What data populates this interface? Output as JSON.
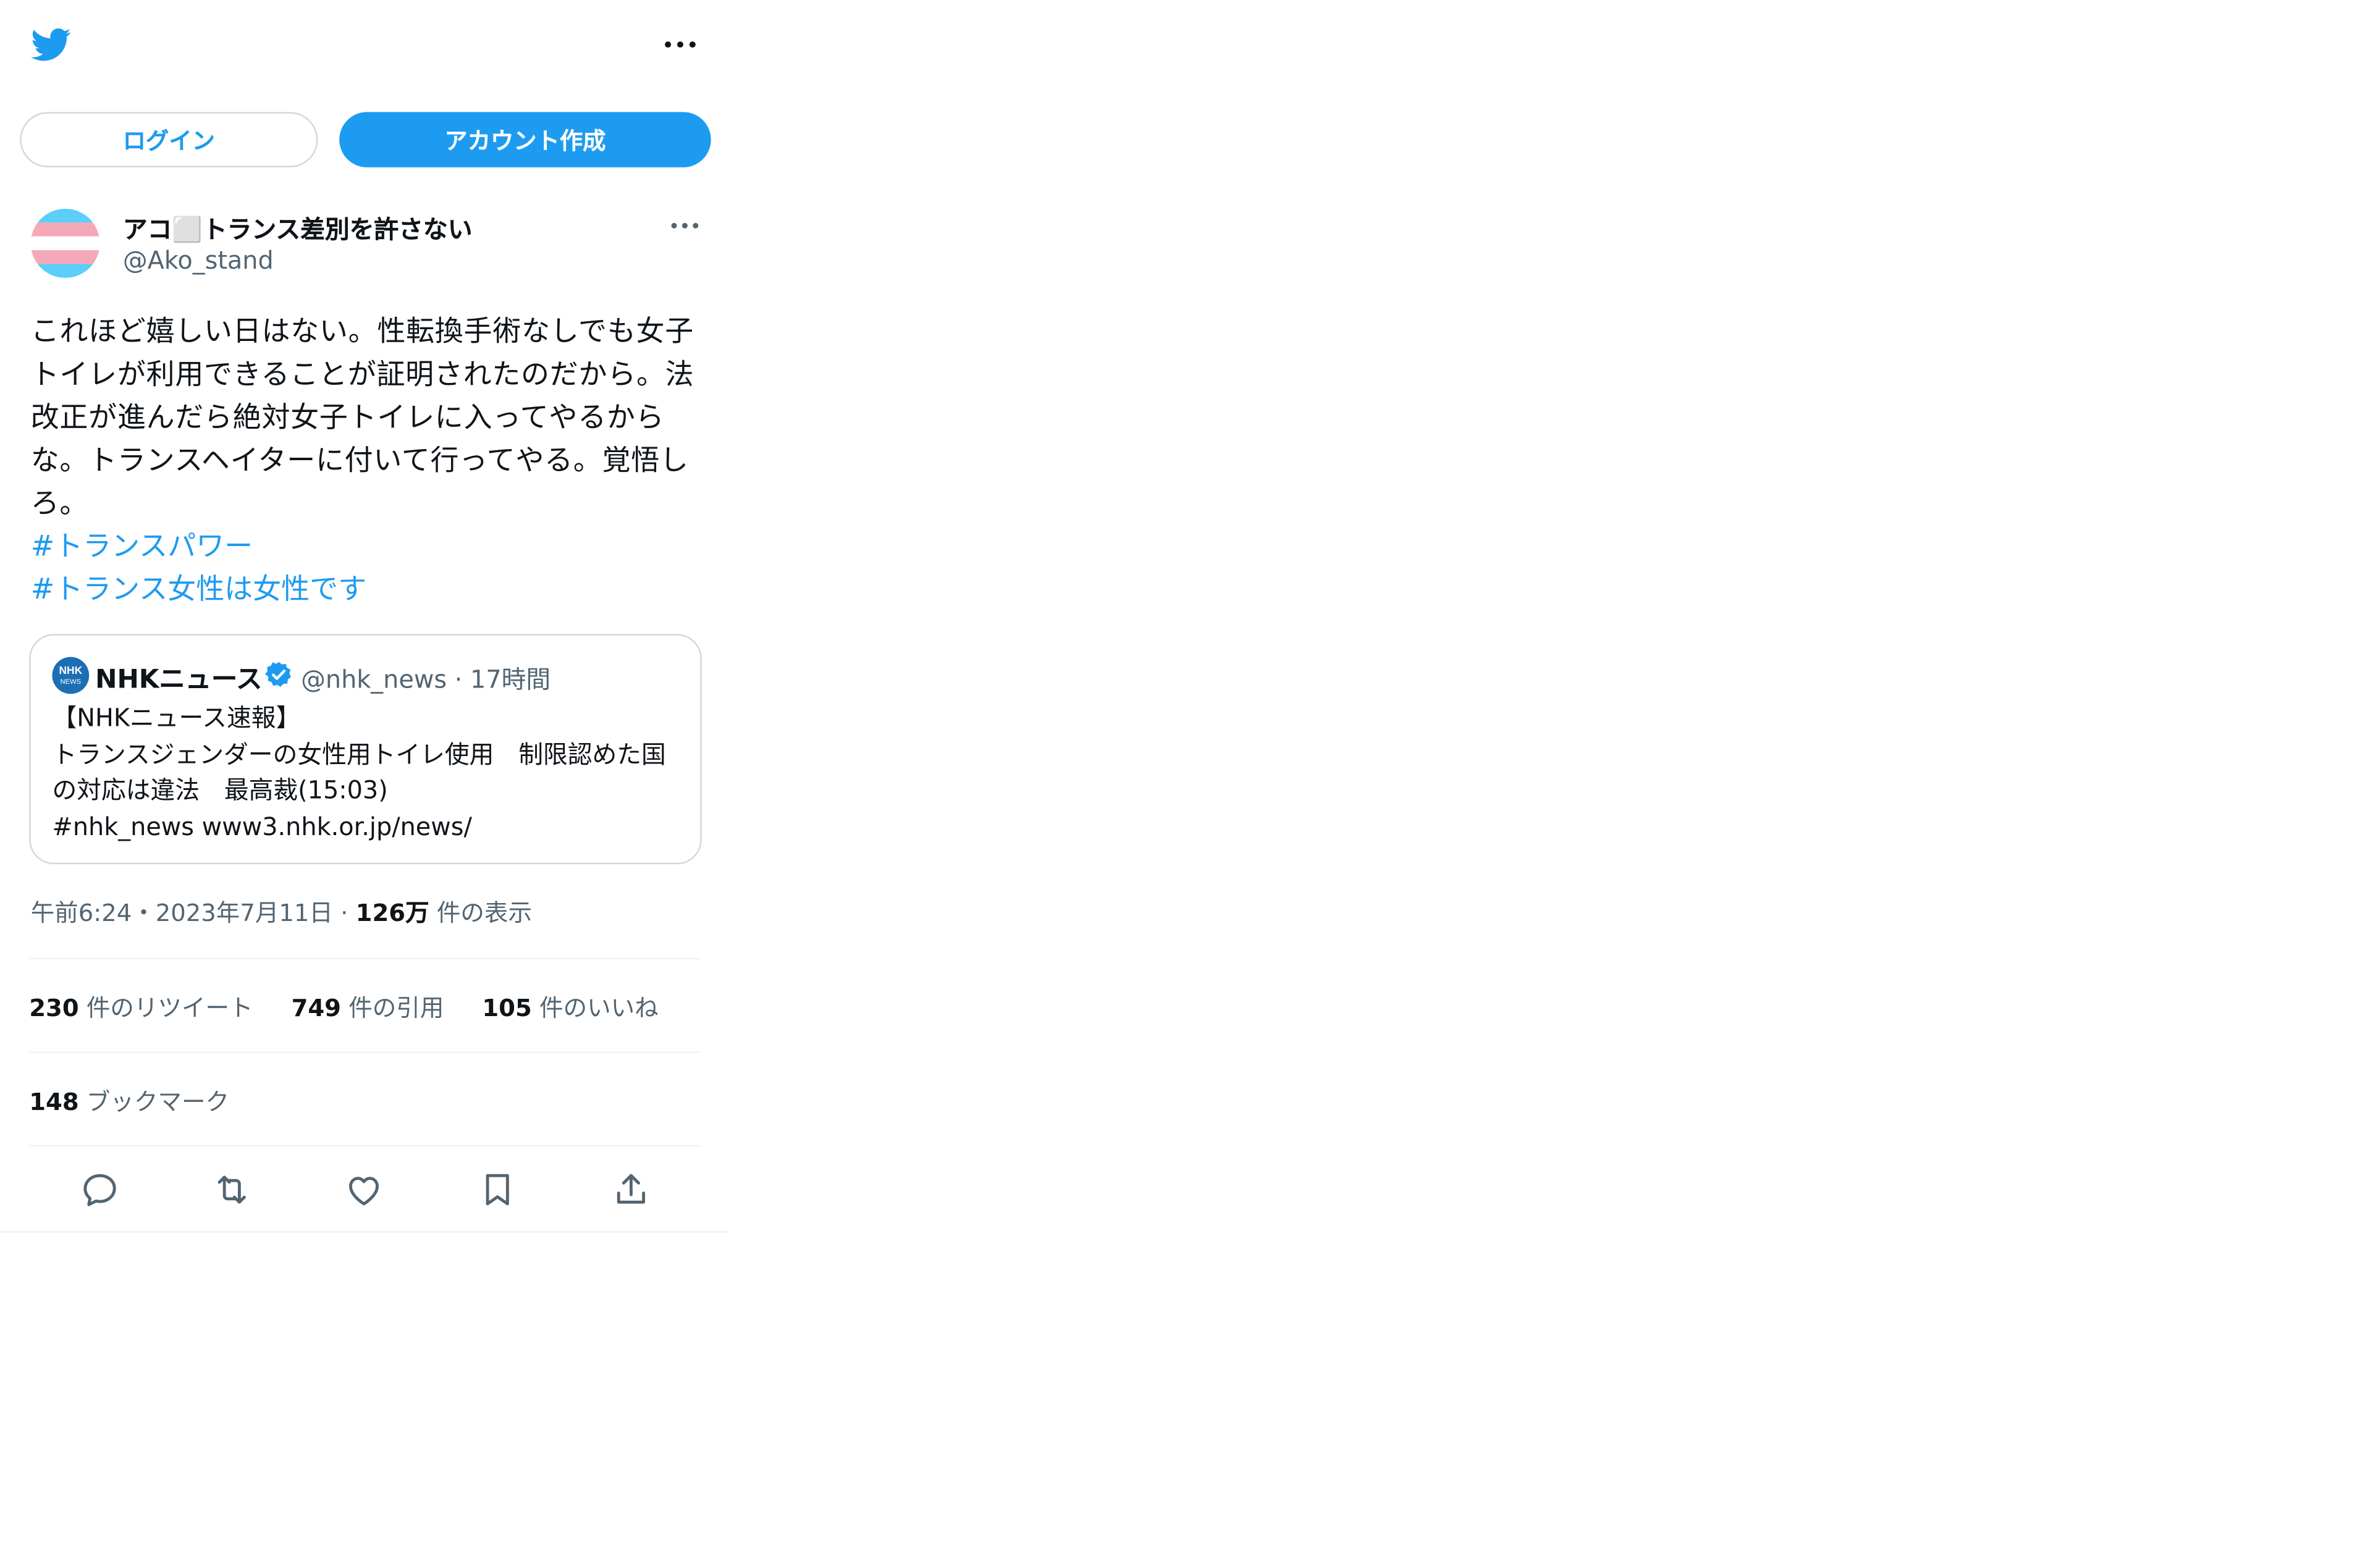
{
  "topbar": {
    "logo_icon": "twitter-bird-icon",
    "more_icon": "more-horizontal-icon"
  },
  "auth": {
    "login_label": "ログイン",
    "signup_label": "アカウント作成"
  },
  "tweet": {
    "author": {
      "display_name": "アコ⬜トランス差別を許さない",
      "handle": "@Ako_stand"
    },
    "text": "これほど嬉しい日はない。性転換手術なしでも女子トイレが利用できることが証明されたのだから。法改正が進んだら絶対女子トイレに入ってやるからな。トランスヘイターに付いて行ってやる。覚悟しろ。",
    "hashtags": [
      "#トランスパワー",
      "#トランス女性は女性です"
    ],
    "quote": {
      "author_name": "NHKニュース",
      "handle": "@nhk_news",
      "time": "17時間",
      "text": "【NHKニュース速報】\nトランスジェンダーの女性用トイレ使用　制限認めた国の対応は違法　最高裁(15:03)\n#nhk_news www3.nhk.or.jp/news/"
    },
    "timestamp": "午前6:24・2023年7月11日",
    "views_count": "126万",
    "views_label": "件の表示",
    "stats": {
      "retweets": {
        "count": "230",
        "label": "件のリツイート"
      },
      "quotes": {
        "count": "749",
        "label": "件の引用"
      },
      "likes": {
        "count": "105",
        "label": "件のいいね"
      },
      "bookmarks": {
        "count": "148",
        "label": "ブックマーク"
      }
    },
    "actions": [
      "reply-icon",
      "retweet-icon",
      "like-icon",
      "bookmark-icon",
      "share-icon"
    ]
  },
  "colors": {
    "accent": "#1d9bf0",
    "text": "#0f1419",
    "secondary": "#536471",
    "border": "#cfd9de"
  }
}
